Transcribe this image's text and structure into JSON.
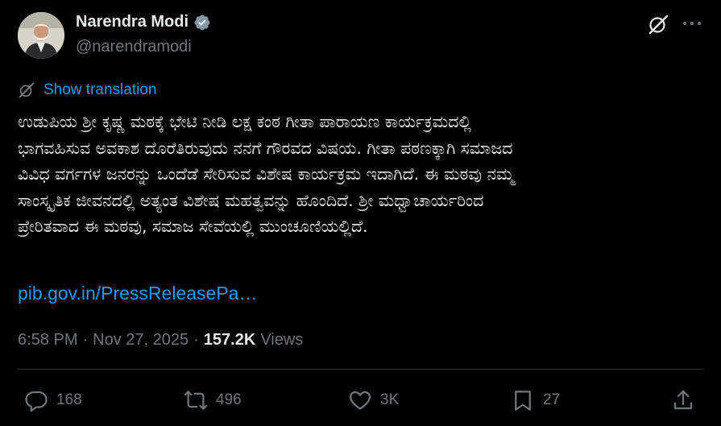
{
  "author": {
    "name": "Narendra Modi",
    "handle": "@narendramodi",
    "verified": true
  },
  "translate": {
    "label": "Show translation"
  },
  "tweet": {
    "text": "ಉಡುಪಿಯ ಶ್ರೀ ಕೃಷ್ಣ ಮಠಕ್ಕೆ ಭೇಟಿ ನೀಡಿ ಲಕ್ಷ ಕಂಠ ಗೀತಾ ಪಾರಾಯಣ ಕಾರ್ಯಕ್ರಮದಲ್ಲಿ\nಭಾಗವಹಿಸುವ ಅವಕಾಶ ದೊರೆತಿರುವುದು ನನಗೆ ಗೌರವದ ವಿಷಯ. ಗೀತಾ ಪಠಣಕ್ಕಾಗಿ ಸಮಾಜದ\nವಿವಿಧ ವರ್ಗಗಳ ಜನರನ್ನು ಒಂದೆಡೆ ಸೇರಿಸುವ ವಿಶೇಷ ಕಾರ್ಯಕ್ರಮ ಇದಾಗಿದೆ. ಈ ಮಠವು ನಮ್ಮ\nಸಾಂಸ್ಕೃತಿಕ ಜೀವನದಲ್ಲಿ ಅತ್ಯಂತ ವಿಶೇಷ ಮಹತ್ವವನ್ನು ಹೊಂದಿದೆ. ಶ್ರೀ ಮಧ್ವಾಚಾರ್ಯರಿಂದ\nಪ್ರೇರಿತವಾದ ಈ ಮಠವು, ಸಮಾಜ ಸೇವೆಯಲ್ಲಿ ಮುಂಚೂಣಿಯಲ್ಲಿದೆ.",
    "link": "pib.gov.in/PressReleasePa…"
  },
  "meta": {
    "time": "6:58 PM",
    "date": "Nov 27, 2025",
    "separator": "·",
    "views_count": "157.2K",
    "views_label": "Views"
  },
  "actions": {
    "replies": "168",
    "reposts": "496",
    "likes": "3K",
    "bookmarks": "27"
  },
  "colors": {
    "background": "#000000",
    "text": "#e7e9ea",
    "muted": "#71767b",
    "link": "#1d9bf0",
    "divider": "#2f3336"
  }
}
